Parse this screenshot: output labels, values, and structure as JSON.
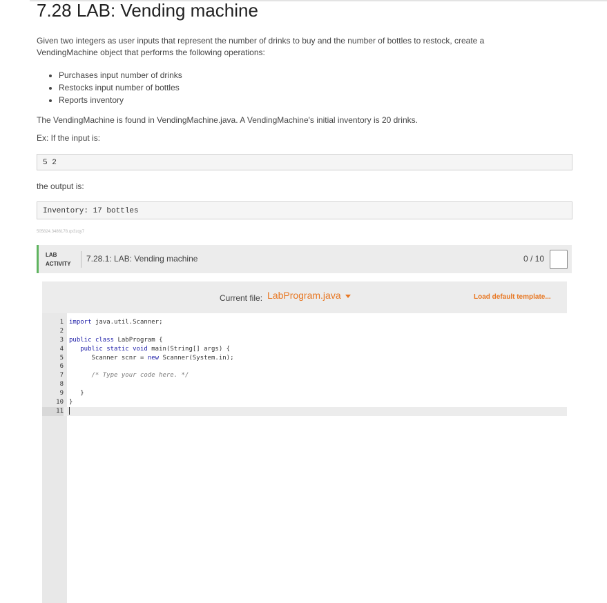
{
  "page": {
    "title": "7.28 LAB: Vending machine",
    "intro": "Given two integers as user inputs that represent the number of drinks to buy and the number of bottles to restock, create a VendingMachine object that performs the following operations:",
    "bullets": [
      "Purchases input number of drinks",
      "Restocks input number of bottles",
      "Reports inventory"
    ],
    "found_in": "The VendingMachine is found in VendingMachine.java. A VendingMachine's initial inventory is 20 drinks.",
    "example_label": "Ex: If the input is:",
    "example_input": "5 2",
    "output_label": "the output is:",
    "example_output": "Inventory: 17 bottles",
    "id_tag": "505824.3486178.qx3zqy7"
  },
  "lab": {
    "label_line1": "LAB",
    "label_line2": "ACTIVITY",
    "title": "7.28.1: LAB: Vending machine",
    "score": "0 / 10",
    "accent_color": "#5fb45f"
  },
  "editor": {
    "current_file_label": "Current file:",
    "current_file": "LabProgram.java",
    "load_default": "Load default template...",
    "link_color": "#e87722",
    "lines": [
      {
        "n": "1",
        "code": "import java.util.Scanner;"
      },
      {
        "n": "2",
        "code": ""
      },
      {
        "n": "3",
        "code": "public class LabProgram {"
      },
      {
        "n": "4",
        "code": "   public static void main(String[] args) {"
      },
      {
        "n": "5",
        "code": "      Scanner scnr = new Scanner(System.in);"
      },
      {
        "n": "6",
        "code": ""
      },
      {
        "n": "7",
        "code": "      /* Type your code here. */"
      },
      {
        "n": "8",
        "code": ""
      },
      {
        "n": "9",
        "code": "   }"
      },
      {
        "n": "10",
        "code": "}"
      },
      {
        "n": "11",
        "code": ""
      }
    ]
  }
}
